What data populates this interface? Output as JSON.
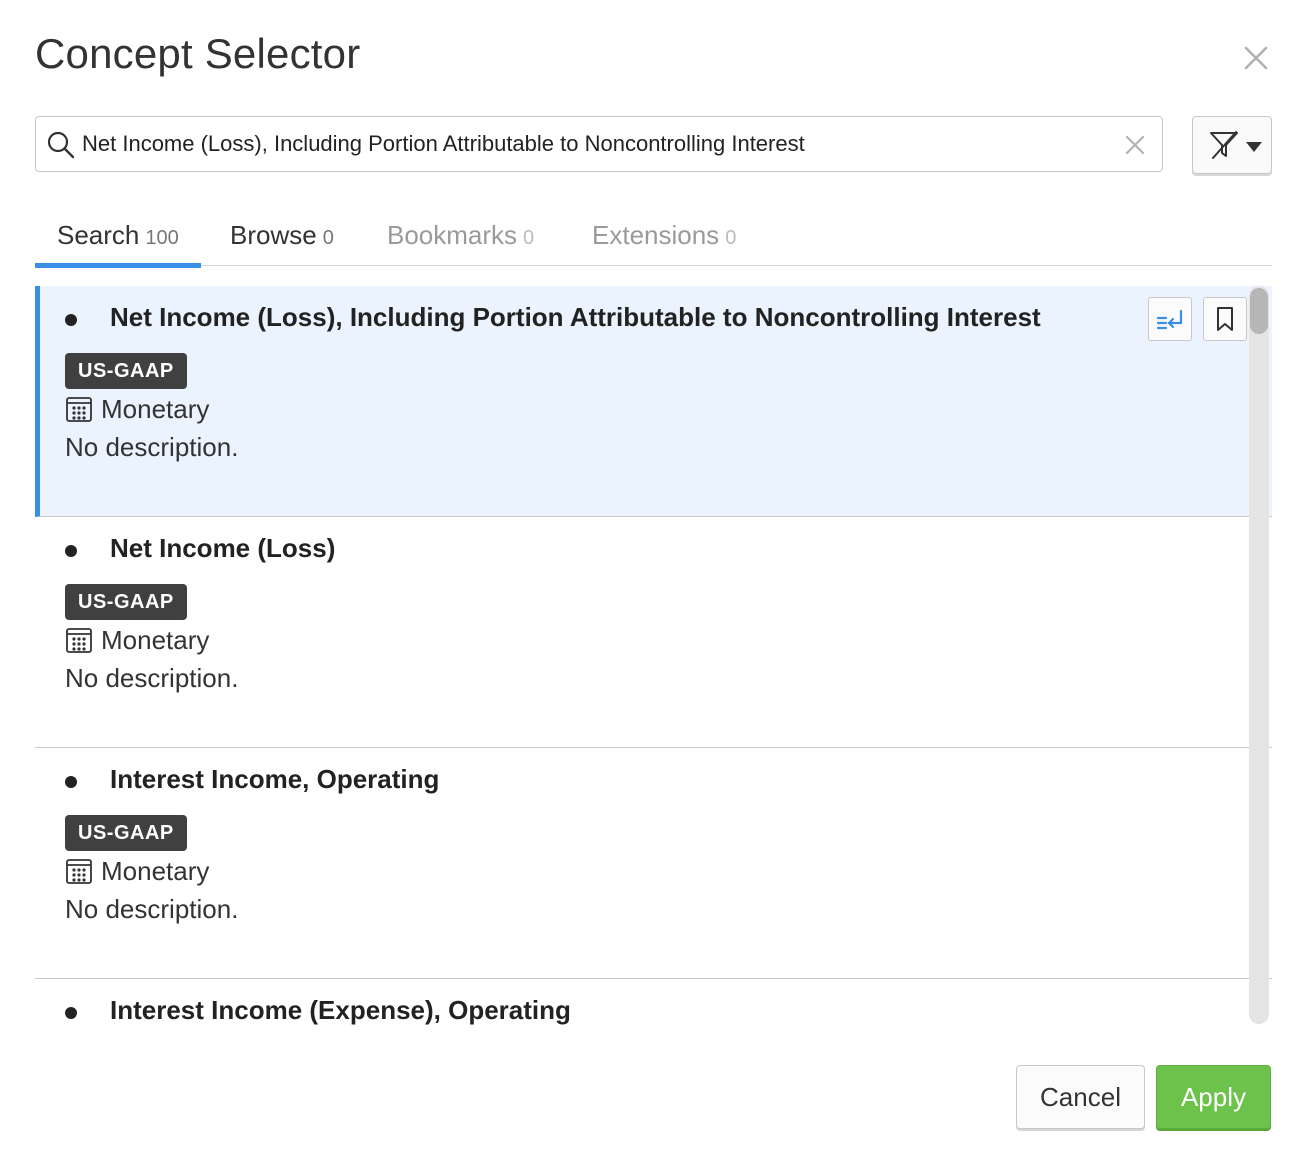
{
  "dialog": {
    "title": "Concept Selector"
  },
  "search": {
    "value": "Net Income (Loss), Including Portion Attributable to Noncontrolling Interest",
    "placeholder": ""
  },
  "tabs": [
    {
      "label": "Search",
      "count": "100"
    },
    {
      "label": "Browse",
      "count": "0"
    },
    {
      "label": "Bookmarks",
      "count": "0"
    },
    {
      "label": "Extensions",
      "count": "0"
    }
  ],
  "results": [
    {
      "name": "Net Income (Loss), Including Portion Attributable to Noncontrolling Interest",
      "taxonomy": "US-GAAP",
      "type": "Monetary",
      "description": "No description."
    },
    {
      "name": "Net Income (Loss)",
      "taxonomy": "US-GAAP",
      "type": "Monetary",
      "description": "No description."
    },
    {
      "name": "Interest Income, Operating",
      "taxonomy": "US-GAAP",
      "type": "Monetary",
      "description": "No description."
    },
    {
      "name": "Interest Income (Expense), Operating",
      "taxonomy": "",
      "type": "",
      "description": ""
    }
  ],
  "footer": {
    "cancel_label": "Cancel",
    "apply_label": "Apply"
  },
  "icons": {
    "close": "close-icon",
    "search": "search-icon",
    "clear": "clear-icon",
    "filter": "filter-off-icon",
    "insert": "insert-icon",
    "bookmark": "bookmark-icon",
    "type": "calendar-icon"
  },
  "colors": {
    "accent": "#3a8ee6",
    "selected_bg": "#eaf3fe",
    "badge_bg": "#404040",
    "apply_bg": "#6cc24a"
  }
}
